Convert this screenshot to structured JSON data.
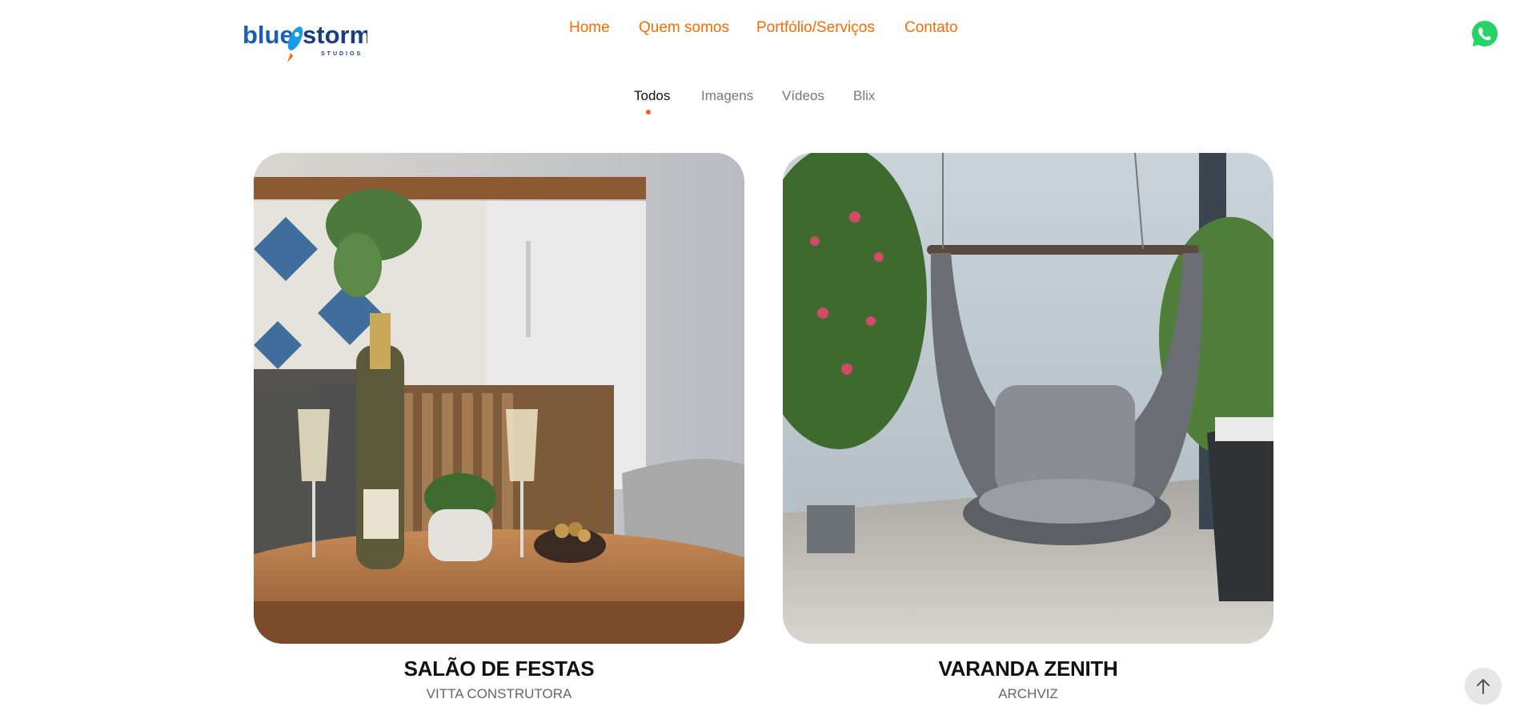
{
  "brand": {
    "logo_text_blue": "blue",
    "logo_text_storm": "storm",
    "logo_sub": "STUDIOS",
    "accent": "#ff6a00",
    "logo_blue": "#1a5fb4"
  },
  "nav": {
    "items": [
      {
        "label": "Home"
      },
      {
        "label": "Quem somos"
      },
      {
        "label": "Portfólio/Serviços"
      },
      {
        "label": "Contato"
      }
    ]
  },
  "whatsapp": {
    "icon": "whatsapp-icon",
    "color": "#25d366"
  },
  "filters": {
    "active": "Todos",
    "items": [
      {
        "label": "Todos"
      },
      {
        "label": "Imagens"
      },
      {
        "label": "Vídeos"
      },
      {
        "label": "Blix"
      }
    ]
  },
  "cards": [
    {
      "title": "SALÃO DE FESTAS",
      "client": "VITTA CONSTRUTORA"
    },
    {
      "title": "VARANDA ZENITH",
      "client": "ARCHVIZ"
    }
  ],
  "back_to_top": {
    "icon": "arrow-up-icon"
  }
}
